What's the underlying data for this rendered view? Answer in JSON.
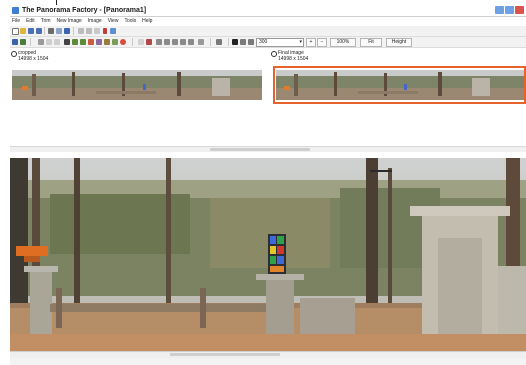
{
  "window": {
    "title": "The Panorama Factory - [Panorama1]",
    "controls": [
      "minimize",
      "maximize",
      "close"
    ]
  },
  "menu": {
    "items": [
      "File",
      "Edit",
      "Trim",
      "New Image",
      "Image",
      "View",
      "Tools",
      "Help"
    ]
  },
  "toolbar2": {
    "zoom_value": "300",
    "zoom_pct": "100%",
    "fit_label": "Fit",
    "height_label": "Height"
  },
  "images": {
    "cropped": {
      "name": "cropped",
      "dims": "14998 x 1504"
    },
    "final": {
      "name": "Final image",
      "dims": "14998 x 1504"
    }
  },
  "colors": {
    "selection": "#e8632c",
    "sky": "#c7c9c8",
    "trees": "#6f7a55",
    "ground": "#8a6b4e"
  }
}
